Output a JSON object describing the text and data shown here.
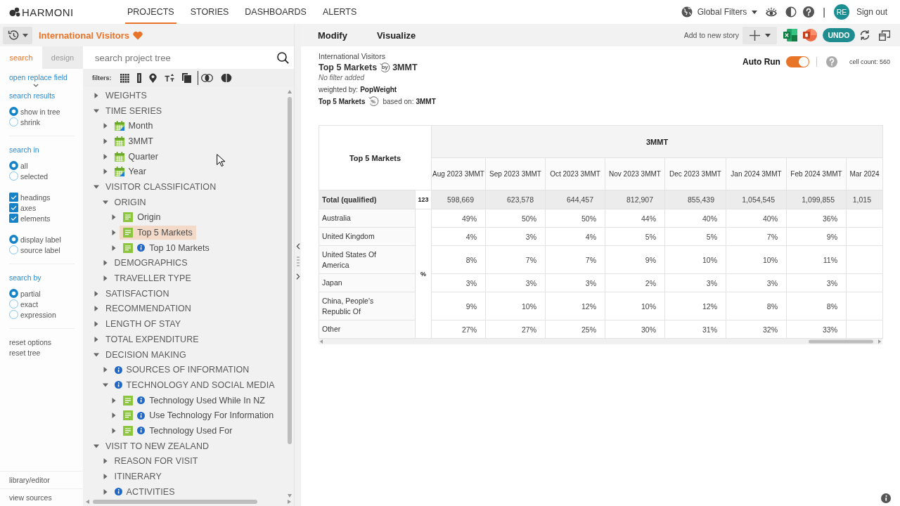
{
  "nav": {
    "logo": "HARMONI",
    "tabs": [
      {
        "label": "PROJECTS",
        "selected": true
      },
      {
        "label": "STORIES",
        "selected": false
      },
      {
        "label": "DASHBOARDS",
        "selected": false
      },
      {
        "label": "ALERTS",
        "selected": false
      }
    ],
    "global_filters": "Global Filters",
    "separator": "|",
    "avatar": "RE",
    "sign_out": "Sign out"
  },
  "project": {
    "title": "International Visitors",
    "favorite": true
  },
  "toolbar": {
    "tabs": [
      "Modify",
      "Visualize"
    ],
    "add_to_story": "Add to new story",
    "undo": "UNDO"
  },
  "side_tabs": [
    {
      "label": "search",
      "selected": true
    },
    {
      "label": "design",
      "selected": false
    }
  ],
  "search_options": {
    "replace_link": "open replace field",
    "groups": [
      {
        "heading": "search results",
        "sets": [
          [
            {
              "kind": "radio",
              "label": "show in tree",
              "checked": true
            },
            {
              "kind": "radio",
              "label": "shrink",
              "checked": false
            }
          ]
        ]
      },
      {
        "heading": "search in",
        "sets": [
          [
            {
              "kind": "radio",
              "label": "all",
              "checked": true
            },
            {
              "kind": "radio",
              "label": "selected",
              "checked": false
            }
          ],
          [
            {
              "kind": "checkbox",
              "label": "headings",
              "checked": true
            },
            {
              "kind": "checkbox",
              "label": "axes",
              "checked": true
            },
            {
              "kind": "checkbox",
              "label": "elements",
              "checked": true
            }
          ],
          [
            {
              "kind": "radio",
              "label": "display label",
              "checked": true
            },
            {
              "kind": "radio",
              "label": "source label",
              "checked": false
            }
          ]
        ]
      },
      {
        "heading": "search by",
        "sets": [
          [
            {
              "kind": "radio",
              "label": "partial",
              "checked": true
            },
            {
              "kind": "radio",
              "label": "exact",
              "checked": false
            },
            {
              "kind": "radio",
              "label": "expression",
              "checked": false
            }
          ]
        ]
      }
    ],
    "links": [
      "reset options",
      "reset tree"
    ],
    "footer": [
      "library/editor",
      "view sources"
    ]
  },
  "tree": {
    "placeholder": "search project tree",
    "filters_label": "filters:",
    "nodes": [
      {
        "label": "WEIGHTS",
        "kind": "folder",
        "info": false,
        "expanded": false,
        "selected": false
      },
      {
        "label": "TIME SERIES",
        "kind": "folder",
        "info": false,
        "expanded": true,
        "selected": false,
        "children": [
          {
            "label": "Month",
            "kind": "dateflag",
            "info": false,
            "expanded": false,
            "selected": false
          },
          {
            "label": "3MMT",
            "kind": "date",
            "info": false,
            "expanded": false,
            "selected": false
          },
          {
            "label": "Quarter",
            "kind": "date",
            "info": false,
            "expanded": false,
            "selected": false
          },
          {
            "label": "Year",
            "kind": "dateflag",
            "info": false,
            "expanded": false,
            "selected": false
          }
        ]
      },
      {
        "label": "VISITOR CLASSIFICATION",
        "kind": "folder",
        "info": false,
        "expanded": true,
        "selected": false,
        "children": [
          {
            "label": "ORIGIN",
            "kind": "folder",
            "info": false,
            "expanded": true,
            "selected": false,
            "children": [
              {
                "label": "Origin",
                "kind": "variable",
                "info": false,
                "expanded": false,
                "selected": false
              },
              {
                "label": "Top 5 Markets",
                "kind": "variable",
                "info": false,
                "expanded": false,
                "selected": true
              },
              {
                "label": "Top 10 Markets",
                "kind": "variable",
                "info": true,
                "expanded": false,
                "selected": false
              }
            ]
          },
          {
            "label": "DEMOGRAPHICS",
            "kind": "folder",
            "info": false,
            "expanded": false,
            "selected": false
          },
          {
            "label": "TRAVELLER TYPE",
            "kind": "folder",
            "info": false,
            "expanded": false,
            "selected": false
          }
        ]
      },
      {
        "label": "SATISFACTION",
        "kind": "folder",
        "info": false,
        "expanded": false,
        "selected": false
      },
      {
        "label": "RECOMMENDATION",
        "kind": "folder",
        "info": false,
        "expanded": false,
        "selected": false
      },
      {
        "label": "LENGTH OF STAY",
        "kind": "folder",
        "info": false,
        "expanded": false,
        "selected": false
      },
      {
        "label": "TOTAL EXPENDITURE",
        "kind": "folder",
        "info": false,
        "expanded": false,
        "selected": false
      },
      {
        "label": "DECISION MAKING",
        "kind": "folder",
        "info": false,
        "expanded": true,
        "selected": false,
        "children": [
          {
            "label": "SOURCES OF INFORMATION",
            "kind": "folder",
            "info": true,
            "expanded": false,
            "selected": false
          },
          {
            "label": "TECHNOLOGY AND SOCIAL MEDIA",
            "kind": "folder",
            "info": true,
            "expanded": true,
            "selected": false,
            "children": [
              {
                "label": "Technology Used While In NZ",
                "kind": "variable",
                "info": true,
                "expanded": false,
                "selected": false
              },
              {
                "label": "Use Technology For Information",
                "kind": "variable",
                "info": true,
                "expanded": false,
                "selected": false
              },
              {
                "label": "Technology Used For",
                "kind": "variable",
                "info": true,
                "expanded": false,
                "selected": false
              }
            ]
          }
        ]
      },
      {
        "label": "VISIT TO NEW ZEALAND",
        "kind": "folder",
        "info": false,
        "expanded": true,
        "selected": false,
        "children": [
          {
            "label": "REASON FOR VISIT",
            "kind": "folder",
            "info": false,
            "expanded": false,
            "selected": false
          },
          {
            "label": "ITINERARY",
            "kind": "folder",
            "info": false,
            "expanded": false,
            "selected": false
          },
          {
            "label": "ACTIVITIES",
            "kind": "folder",
            "info": true,
            "expanded": false,
            "selected": false
          }
        ]
      }
    ]
  },
  "query": {
    "project": "International Visitors",
    "variable": "Top 5 Markets",
    "by_mark": "by",
    "axis": "3MMT",
    "filter": "No filter added",
    "weight_label": "weighted by:",
    "weight": "PopWeight",
    "base_variable": "Top 5 Markets",
    "base_mark": "%",
    "base_label": "based on:",
    "base": "3MMT"
  },
  "auto_run": {
    "label": "Auto Run",
    "on": true
  },
  "cell_count": "cell count: 560",
  "table": {
    "corner": "Top 5 Markets",
    "group": "3MMT",
    "columns": [
      "Aug 2023 3MMT",
      "Sep 2023 3MMT",
      "Oct 2023 3MMT",
      "Nov 2023 3MMT",
      "Dec 2023 3MMT",
      "Jan 2024 3MMT",
      "Feb 2024 3MMT",
      "Mar 2024"
    ],
    "total": {
      "label": "Total (qualified)",
      "stat": "123",
      "values": [
        "598,669",
        "623,578",
        "644,457",
        "812,907",
        "855,439",
        "1,054,545",
        "1,099,855",
        "1,015"
      ]
    },
    "stat": "%",
    "rows": [
      {
        "label": "Australia",
        "values": [
          "49%",
          "50%",
          "50%",
          "44%",
          "40%",
          "40%",
          "36%"
        ]
      },
      {
        "label": "United Kingdom",
        "values": [
          "4%",
          "3%",
          "4%",
          "5%",
          "5%",
          "7%",
          "9%"
        ]
      },
      {
        "label": "United States Of America",
        "values": [
          "8%",
          "7%",
          "7%",
          "9%",
          "10%",
          "10%",
          "11%"
        ]
      },
      {
        "label": "Japan",
        "values": [
          "3%",
          "3%",
          "3%",
          "2%",
          "3%",
          "3%",
          "3%"
        ]
      },
      {
        "label": "China, People's Republic Of",
        "values": [
          "9%",
          "10%",
          "12%",
          "10%",
          "12%",
          "8%",
          "8%"
        ]
      },
      {
        "label": "Other",
        "values": [
          "27%",
          "27%",
          "25%",
          "30%",
          "31%",
          "32%",
          "33%"
        ]
      }
    ]
  }
}
